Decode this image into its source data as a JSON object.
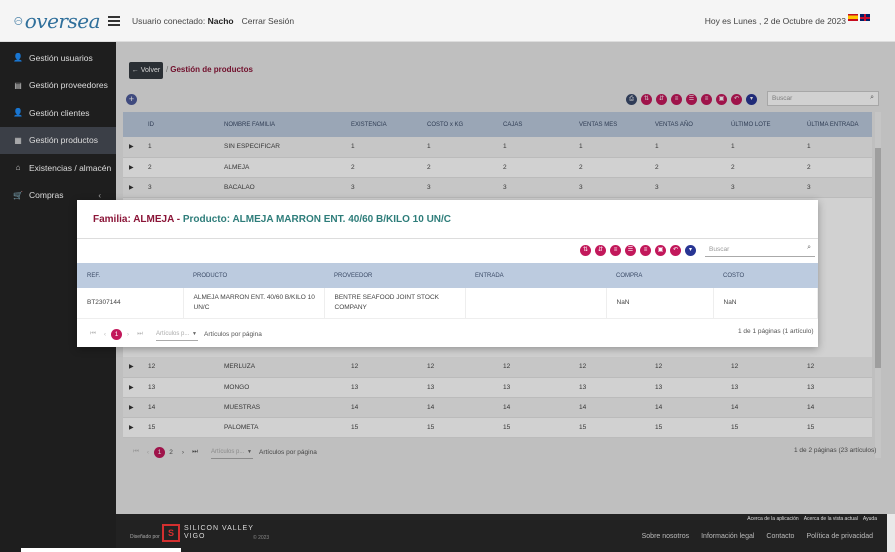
{
  "header": {
    "logo_text": "oversea",
    "user_prefix": "Usuario conectado:",
    "user_name": "Nacho",
    "logout": "Cerrar Sesión",
    "date": "Hoy es Lunes , 2 de Octubre de 2023"
  },
  "sidebar": {
    "items": [
      {
        "label": "Gestión usuarios",
        "icon": "user-plus-icon"
      },
      {
        "label": "Gestión proveedores",
        "icon": "building-icon"
      },
      {
        "label": "Gestión clientes",
        "icon": "user-plus-icon"
      },
      {
        "label": "Gestión productos",
        "icon": "boxes-icon"
      },
      {
        "label": "Existencias / almacén",
        "icon": "warehouse-icon"
      },
      {
        "label": "Compras",
        "icon": "cart-icon"
      }
    ]
  },
  "main": {
    "back_label": "← Volver",
    "breadcrumb": "Gestión de productos",
    "search_placeholder": "Buscar",
    "columns": [
      "ID",
      "NOMBRE FAMILIA",
      "EXISTENCIA",
      "COSTO x KG",
      "CAJAS",
      "VENTAS MES",
      "VENTAS AÑO",
      "ÚLTIMO LOTE",
      "ÚLTIMA ENTRADA"
    ],
    "rows_top": [
      [
        "1",
        "SIN ESPECIFICAR",
        "1",
        "1",
        "1",
        "1",
        "1",
        "1",
        "1"
      ],
      [
        "2",
        "ALMEJA",
        "2",
        "2",
        "2",
        "2",
        "2",
        "2",
        "2"
      ],
      [
        "3",
        "BACALAO",
        "3",
        "3",
        "3",
        "3",
        "3",
        "3",
        "3"
      ]
    ],
    "rows_bottom": [
      [
        "12",
        "MERLUZA",
        "12",
        "12",
        "12",
        "12",
        "12",
        "12",
        "12"
      ],
      [
        "13",
        "MONGO",
        "13",
        "13",
        "13",
        "13",
        "13",
        "13",
        "13"
      ],
      [
        "14",
        "MUESTRAS",
        "14",
        "14",
        "14",
        "14",
        "14",
        "14",
        "14"
      ],
      [
        "15",
        "PALOMETA",
        "15",
        "15",
        "15",
        "15",
        "15",
        "15",
        "15"
      ]
    ],
    "pager": {
      "pages": [
        "1",
        "2"
      ],
      "per_page_placeholder": "Artículos p...",
      "per_page_label": "Artículos por página",
      "info": "1 de 2 páginas (23 artículos)"
    }
  },
  "modal": {
    "title_family": "Familia: ALMEJA - ",
    "title_product": "Producto: ALMEJA MARRON ENT. 40/60 B/KILO 10 UN/C",
    "search_placeholder": "Buscar",
    "columns": [
      "REF.",
      "PRODUCTO",
      "PROVEEDOR",
      "ENTRADA",
      "COMPRA",
      "COSTO"
    ],
    "rows": [
      [
        "BT2307144",
        "ALMEJA MARRON ENT. 40/60 B/KILO 10 UN/C",
        "BENTRE SEAFOOD JOINT STOCK COMPANY",
        "",
        "NaN",
        "NaN"
      ]
    ],
    "pager": {
      "pages": [
        "1"
      ],
      "per_page_placeholder": "Artículos p...",
      "per_page_label": "Artículos por página",
      "info": "1 de 1 páginas (1 artículo)"
    }
  },
  "footer": {
    "top_links": [
      "Acerca de la aplicación",
      "Acerca de la vista actual",
      "Ayuda"
    ],
    "by": "Diseñado por",
    "brand_line1": "SILICON VALLEY",
    "brand_line2": "VIGO",
    "year": "© 2023",
    "links": [
      "Sobre nosotros",
      "Información legal",
      "Contacto",
      "Política de privacidad"
    ]
  },
  "colors": {
    "brand": "#8b1538",
    "accent_teal": "#2e7d7a",
    "table_header": "#bccbdf",
    "pagination_active": "#c2185b"
  }
}
